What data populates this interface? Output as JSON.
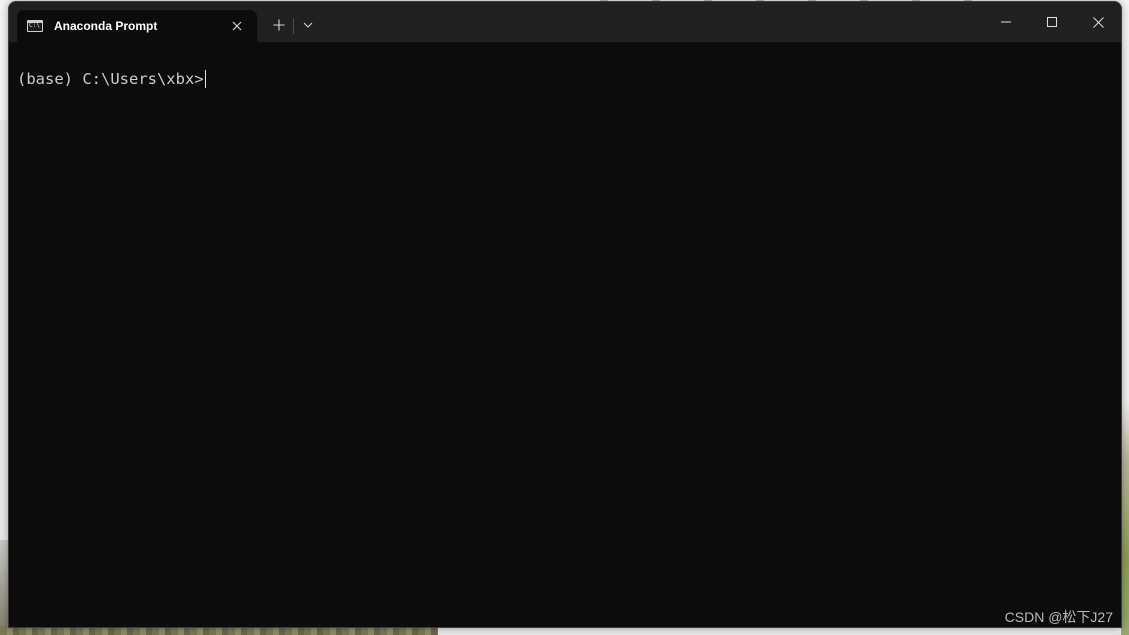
{
  "window": {
    "tab_title": "Anaconda Prompt",
    "tab_icon": "terminal-icon",
    "tab_icon_glyph": "C:\\",
    "buttons": {
      "close_tab": "close-icon",
      "new_tab": "plus-icon",
      "dropdown": "chevron-down-icon",
      "minimize": "minimize-icon",
      "maximize": "maximize-icon",
      "close_window": "close-icon"
    }
  },
  "terminal": {
    "prompt": "(base) C:\\Users\\xbx>"
  },
  "watermark": "CSDN @松下J27",
  "colors": {
    "titlebar": "#202020",
    "terminal_bg": "#0c0c0c",
    "text": "#cccccc"
  }
}
